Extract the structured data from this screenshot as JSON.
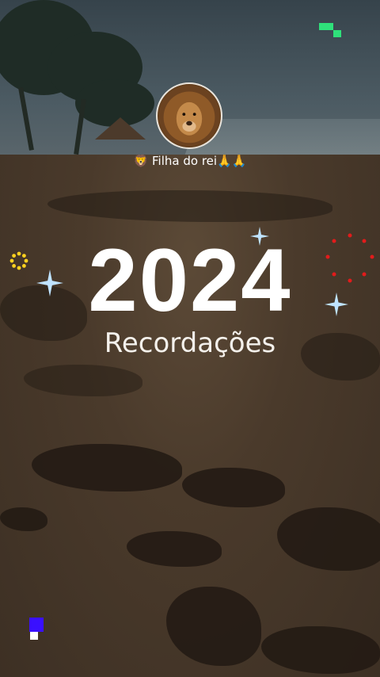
{
  "profile": {
    "name": "🦁 Filha do rei🙏🙏",
    "avatar": "lion-avatar"
  },
  "title": {
    "year": "2024",
    "subtitle": "Recordações"
  },
  "decorations": {
    "sparkle_color": "#bfe3ff",
    "dots_color": "#e21b1b",
    "yellow_ring_color": "#ffd21f",
    "green_block_color": "#2fe07a",
    "blue_block_color": "#3a10ff"
  },
  "background": {
    "scene": "beach-at-dusk"
  }
}
